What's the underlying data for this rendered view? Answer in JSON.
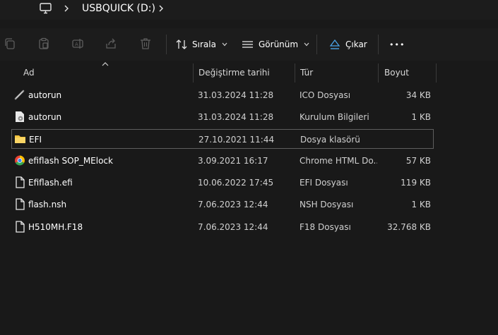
{
  "address": {
    "location": "USBQUICK (D:)"
  },
  "toolbar": {
    "sort_label": "Sırala",
    "view_label": "Görünüm",
    "eject_label": "Çıkar",
    "more_label": "•••"
  },
  "columns": {
    "name": "Ad",
    "date": "Değiştirme tarihi",
    "type": "Tür",
    "size": "Boyut"
  },
  "files": [
    {
      "name": "autorun",
      "date": "31.03.2024 11:28",
      "type": "ICO Dosyası",
      "size": "34 KB",
      "icon": "ico-file-icon"
    },
    {
      "name": "autorun",
      "date": "31.03.2024 11:28",
      "type": "Kurulum Bilgileri",
      "size": "1 KB",
      "icon": "setup-info-icon"
    },
    {
      "name": "EFI",
      "date": "27.10.2021 11:44",
      "type": "Dosya klasörü",
      "size": "",
      "icon": "folder-icon",
      "selected": true
    },
    {
      "name": "efiflash SOP_MElock",
      "date": "3.09.2021 16:17",
      "type": "Chrome HTML Do...",
      "size": "57 KB",
      "icon": "chrome-icon"
    },
    {
      "name": "Efiflash.efi",
      "date": "10.06.2022 17:45",
      "type": "EFI Dosyası",
      "size": "119 KB",
      "icon": "document-icon"
    },
    {
      "name": "flash.nsh",
      "date": "7.06.2023 12:44",
      "type": "NSH Dosyası",
      "size": "1 KB",
      "icon": "document-icon"
    },
    {
      "name": "H510MH.F18",
      "date": "7.06.2023 12:44",
      "type": "F18 Dosyası",
      "size": "32.768 KB",
      "icon": "document-icon"
    }
  ],
  "colors": {
    "background": "#191919",
    "folder": "#f3c33f",
    "selection_border": "#5f5f5f",
    "eject_accent": "#4aa3e8"
  }
}
